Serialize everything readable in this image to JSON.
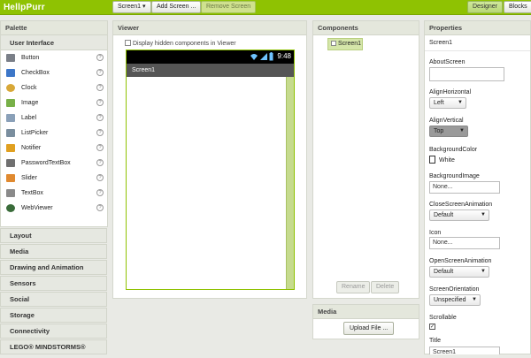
{
  "app": {
    "logo": "HellpPurr"
  },
  "toolbar": {
    "screen_select": "Screen1 ▾",
    "add_screen": "Add Screen ...",
    "remove_screen": "Remove Screen",
    "designer": "Designer",
    "blocks": "Blocks"
  },
  "palette": {
    "title": "Palette",
    "open_category": "User Interface",
    "items": [
      {
        "label": "Button",
        "icon": "button-icon"
      },
      {
        "label": "CheckBox",
        "icon": "checkbox-icon"
      },
      {
        "label": "Clock",
        "icon": "clock-icon"
      },
      {
        "label": "Image",
        "icon": "image-icon"
      },
      {
        "label": "Label",
        "icon": "label-icon"
      },
      {
        "label": "ListPicker",
        "icon": "listpicker-icon"
      },
      {
        "label": "Notifier",
        "icon": "notifier-icon"
      },
      {
        "label": "PasswordTextBox",
        "icon": "password-icon"
      },
      {
        "label": "Slider",
        "icon": "slider-icon"
      },
      {
        "label": "TextBox",
        "icon": "textbox-icon"
      },
      {
        "label": "WebViewer",
        "icon": "webviewer-icon"
      }
    ],
    "help_glyph": "?",
    "categories": [
      "Layout",
      "Media",
      "Drawing and Animation",
      "Sensors",
      "Social",
      "Storage",
      "Connectivity",
      "LEGO® MINDSTORMS®"
    ]
  },
  "viewer": {
    "title": "Viewer",
    "hidden_checkbox_label": "Display hidden components in Viewer",
    "clock": "9:48",
    "screen_title": "Screen1"
  },
  "components": {
    "title": "Components",
    "tree_item": "Screen1",
    "rename": "Rename",
    "delete": "Delete"
  },
  "media": {
    "title": "Media",
    "upload": "Upload File ..."
  },
  "properties": {
    "title": "Properties",
    "component": "Screen1",
    "about_screen_label": "AboutScreen",
    "align_horizontal_label": "AlignHorizontal",
    "align_horizontal_value": "Left",
    "align_vertical_label": "AlignVertical",
    "align_vertical_value": "Top",
    "background_color_label": "BackgroundColor",
    "background_color_value": "White",
    "background_image_label": "BackgroundImage",
    "background_image_value": "None...",
    "close_anim_label": "CloseScreenAnimation",
    "close_anim_value": "Default",
    "icon_label": "Icon",
    "icon_value": "None...",
    "open_anim_label": "OpenScreenAnimation",
    "open_anim_value": "Default",
    "orientation_label": "ScreenOrientation",
    "orientation_value": "Unspecified",
    "scrollable_label": "Scrollable",
    "scrollable_checked": true,
    "title_label": "Title",
    "title_value": "Screen1"
  },
  "colors": {
    "brand": "#8fc202",
    "panel_header": "#e4e7dc"
  }
}
